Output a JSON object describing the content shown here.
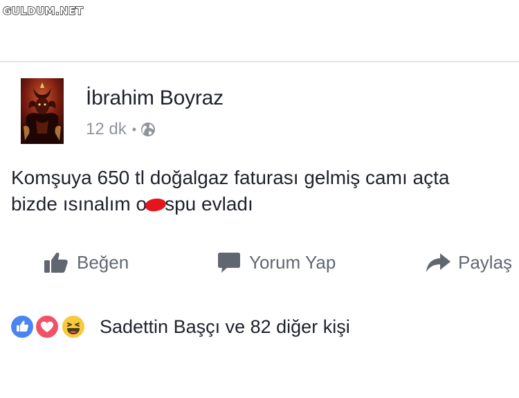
{
  "watermark": {
    "text": "GULDUM.NET"
  },
  "post": {
    "author": {
      "name": "İbrahim Boyraz"
    },
    "meta": {
      "time": "12 dk",
      "separator": "•",
      "privacy_icon": "globe-icon"
    },
    "text": {
      "line1": "Komşuya 650 tl doğalgaz faturası gelmiş camı açta",
      "line2_before": "bizde ısınalım o",
      "line2_after": "spu evladı",
      "censor_color": "#e4151c"
    },
    "actions": [
      {
        "label": "Beğen",
        "icon": "thumbs-up-icon"
      },
      {
        "label": "Yorum Yap",
        "icon": "comment-icon"
      },
      {
        "label": "Paylaş",
        "icon": "share-arrow-icon"
      }
    ],
    "reactions": {
      "icons": [
        "like-reaction-icon",
        "love-reaction-icon",
        "haha-reaction-icon"
      ],
      "summary": "Sadettin Başçı ve 82 diğer kişi"
    }
  },
  "colors": {
    "text_primary": "#1d2129",
    "text_secondary": "#606770",
    "meta_gray": "#90949c",
    "like_blue": "#4b86f0",
    "love_red": "#f25268",
    "haha_yellow": "#f7c93e"
  }
}
